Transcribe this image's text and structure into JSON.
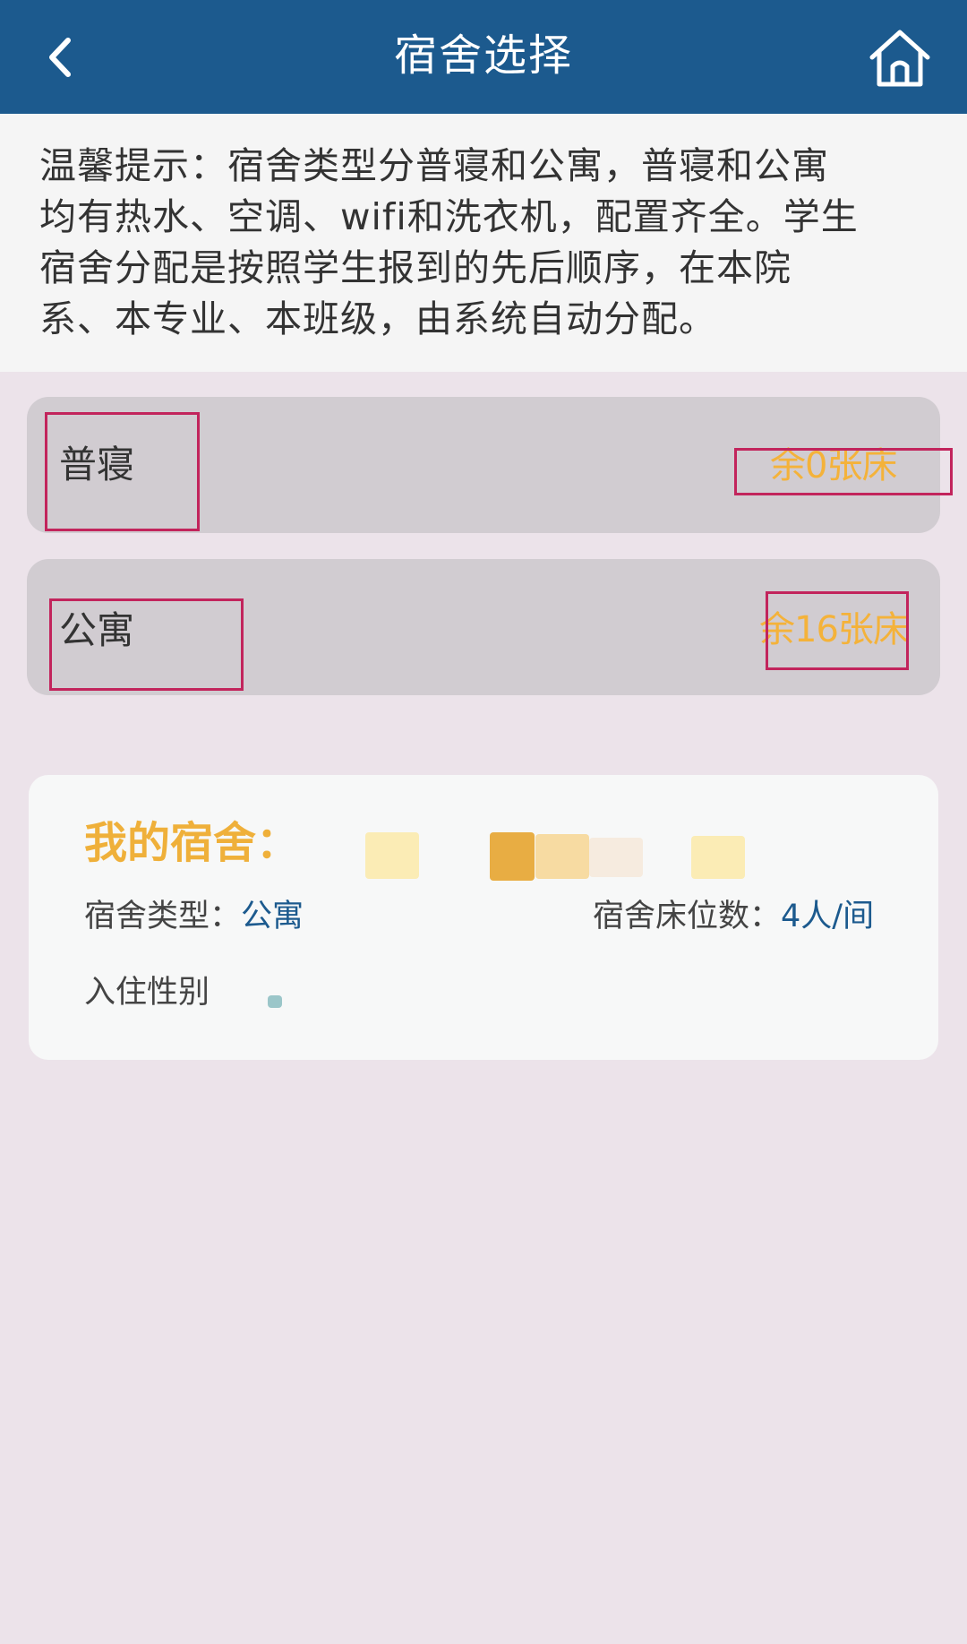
{
  "header": {
    "title": "宿舍选择",
    "back_icon": "chevron-left-icon",
    "home_icon": "home-icon"
  },
  "notice": {
    "line1": "温馨提示：宿舍类型分普寝和公寓，普寝和公寓",
    "line2": "均有热水、空调、wifi和洗衣机，配置齐全。学生",
    "line3": "宿舍分配是按照学生报到的先后顺序，在本院",
    "line4": "系、本专业、本班级，由系统自动分配。"
  },
  "options": [
    {
      "name": "普寝",
      "remaining": "余0张床"
    },
    {
      "name": "公寓",
      "remaining": "余16张床"
    }
  ],
  "my_dorm": {
    "heading": "我的宿舍：",
    "type_label": "宿舍类型：",
    "type_value": "公寓",
    "beds_label": "宿舍床位数：",
    "beds_value": "4人/间",
    "gender_label": "入住性别"
  },
  "colors": {
    "header_bg": "#1c5a8e",
    "accent_orange": "#f4b23a",
    "annotation_red": "#c2245c",
    "page_bg": "#ece3ea"
  }
}
